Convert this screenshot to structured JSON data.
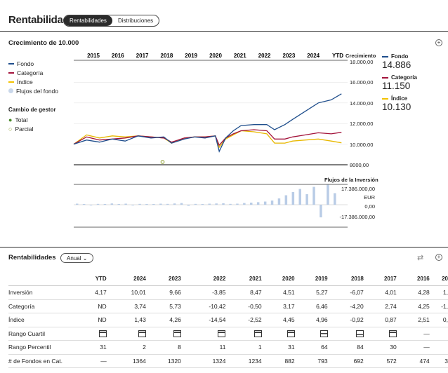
{
  "header": {
    "title": "Rentabilidad",
    "tabs": [
      "Rentabilidades",
      "Distribuciones"
    ]
  },
  "growth": {
    "title": "Crecimiento de 10.000",
    "legend": [
      {
        "label": "Fondo",
        "color": "#1f4e8c",
        "kind": "line"
      },
      {
        "label": "Categoría",
        "color": "#a3133b",
        "kind": "line"
      },
      {
        "label": "Índice",
        "color": "#f2c200",
        "kind": "line"
      },
      {
        "label": "Flujos del fondo",
        "color": "#c9d7ea",
        "kind": "dot"
      }
    ],
    "manager_change": {
      "title": "Cambio de gestor",
      "items": [
        {
          "label": "Total",
          "color": "#4a8a2a"
        },
        {
          "label": "Parcial",
          "color": "#8a9a2a"
        }
      ]
    },
    "years": [
      "2015",
      "2016",
      "2017",
      "2018",
      "2019",
      "2020",
      "2021",
      "2022",
      "2023",
      "2024",
      "YTD"
    ],
    "axis_title": "Crecimiento",
    "yticks": [
      "18.000,00",
      "16.000,00",
      "14.000,00",
      "12.000,00",
      "10.000,00",
      "8000,00"
    ],
    "right_legend": [
      {
        "label": "Fondo",
        "value": "14.886",
        "color": "#1f4e8c"
      },
      {
        "label": "Categoría",
        "value": "11.150",
        "color": "#a3133b"
      },
      {
        "label": "Índice",
        "value": "10.130",
        "color": "#f2c200"
      }
    ]
  },
  "chart_data": [
    {
      "type": "line",
      "x": [
        2014.5,
        2015,
        2015.5,
        2016,
        2016.5,
        2017,
        2017.5,
        2018,
        2018.3,
        2018.8,
        2019.2,
        2019.6,
        2020.0,
        2020.15,
        2020.4,
        2020.7,
        2021,
        2021.5,
        2022,
        2022.3,
        2022.7,
        2023,
        2023.5,
        2024,
        2024.5,
        2024.9
      ],
      "series": [
        {
          "name": "Fondo",
          "values": [
            10000,
            10400,
            10200,
            10500,
            10300,
            10800,
            10600,
            10700,
            10100,
            10500,
            10700,
            10600,
            10800,
            9300,
            10600,
            11300,
            11800,
            11900,
            11900,
            11400,
            11900,
            12400,
            13200,
            14000,
            14300,
            14886
          ]
        },
        {
          "name": "Categoría",
          "values": [
            10000,
            10700,
            10400,
            10500,
            10600,
            10800,
            10700,
            10600,
            10200,
            10600,
            10700,
            10700,
            10800,
            9900,
            10600,
            11000,
            11300,
            11400,
            11300,
            10500,
            10500,
            10700,
            10900,
            11100,
            11000,
            11150
          ]
        },
        {
          "name": "Índice",
          "values": [
            10000,
            10900,
            10600,
            10800,
            10700,
            10800,
            10700,
            10600,
            10100,
            10600,
            10700,
            10700,
            10800,
            9700,
            10500,
            10900,
            11300,
            11200,
            11000,
            10100,
            10100,
            10300,
            10400,
            10500,
            10300,
            10130
          ]
        }
      ],
      "ylim": [
        8000,
        18000
      ]
    },
    {
      "type": "bar",
      "title": "Flujos de la Inversión",
      "yticks": [
        "17.386.000,00",
        "EUR",
        "0,00",
        "-17.386.000,00"
      ],
      "values": [
        0.05,
        0.03,
        -0.02,
        0.04,
        0.02,
        0.06,
        0.03,
        0.05,
        -0.03,
        0.04,
        0.03,
        0.02,
        0.05,
        0.04,
        0.06,
        0.08,
        -0.05,
        0.04,
        0.03,
        0.05,
        0.06,
        0.07,
        0.04,
        0.05,
        0.08,
        0.1,
        0.12,
        0.15,
        0.2,
        0.3,
        0.45,
        0.6,
        0.75,
        0.5,
        0.85,
        -0.6,
        0.95,
        0.55
      ],
      "ylim": [
        -1,
        1
      ]
    }
  ],
  "returns": {
    "title": "Rentabilidades",
    "period": "Anual",
    "columns": [
      "YTD",
      "2024",
      "2023",
      "2022",
      "2021",
      "2020",
      "2019",
      "2018",
      "2017",
      "2016",
      "20"
    ],
    "rows": [
      {
        "label": "Inversión",
        "values": [
          "4,17",
          "10,01",
          "9,66",
          "-3,85",
          "8,47",
          "4,51",
          "5,27",
          "-6,07",
          "4,01",
          "4,28",
          "1,"
        ]
      },
      {
        "label": "Categoría",
        "values": [
          "ND",
          "3,74",
          "5,73",
          "-10,42",
          "-0,50",
          "3,17",
          "6,46",
          "-4,20",
          "2,74",
          "4,25",
          "-1,"
        ]
      },
      {
        "label": "Índice",
        "values": [
          "ND",
          "1,43",
          "4,26",
          "-14,54",
          "-2,52",
          "4,45",
          "4,96",
          "-0,92",
          "0,87",
          "2,51",
          "0,"
        ]
      },
      {
        "label": "Rango Cuartil",
        "values": [
          "",
          "",
          "",
          "",
          "",
          "",
          "",
          "",
          "",
          "",
          ""
        ]
      },
      {
        "label": "Rango Percentil",
        "values": [
          "31",
          "2",
          "8",
          "11",
          "1",
          "31",
          "64",
          "84",
          "30",
          "—",
          ""
        ]
      },
      {
        "label": "# de Fondos en Cat.",
        "values": [
          "—",
          "1364",
          "1320",
          "1324",
          "1234",
          "882",
          "793",
          "692",
          "572",
          "474",
          "3"
        ]
      }
    ],
    "quartiles": [
      0,
      0,
      0,
      0,
      0,
      0,
      1,
      2,
      0,
      3,
      3
    ]
  }
}
